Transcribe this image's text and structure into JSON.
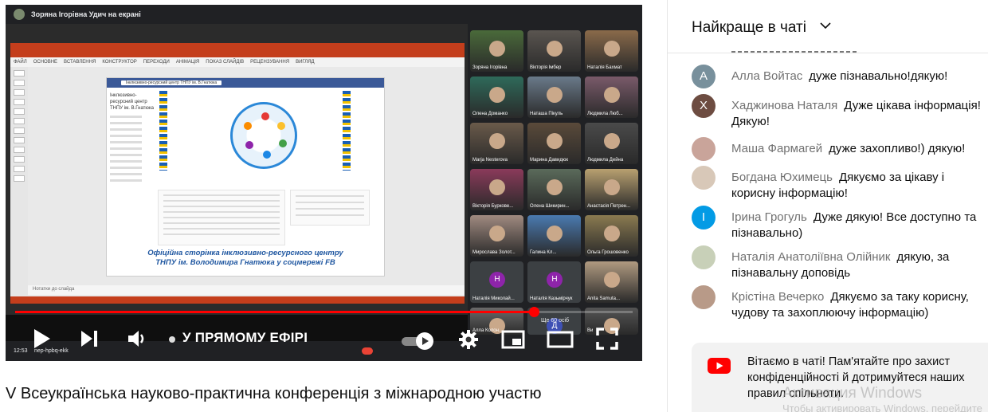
{
  "video": {
    "presenter_banner": "Зоряна Ігорівна Удич на екрані",
    "ppt_tabs": [
      "ФАЙЛ",
      "ОСНОВНЕ",
      "ВСТАВЛЕННЯ",
      "КОНСТРУКТОР",
      "ПЕРЕХОДИ",
      "АНІМАЦІЯ",
      "ПОКАЗ СЛАЙДІВ",
      "РЕЦЕНЗУВАННЯ",
      "ВИГЛЯД"
    ],
    "slide": {
      "fb_page_name": "Інклюзивно-ресурсний центр ТНПУ ім. В.Гнатюка",
      "side_title": "Інклюзивно-ресурсний центр ТНПУ ім. В.Гнатюка",
      "caption_line1": "Офіційна сторінка інклюзивно-ресурсного центру",
      "caption_line2": "ТНПУ ім. Володимира Гнатюка у соцмережі FB"
    },
    "notes_label": "Нотатки до слайда",
    "participants": [
      {
        "name": "Зоряна Ігорівна",
        "color": "#4a6a3a"
      },
      {
        "name": "Вікторія Імбер",
        "color": "#5a5550"
      },
      {
        "name": "Наталія Бахмат",
        "color": "#8a6a4a"
      },
      {
        "name": "Олена Доманко",
        "color": "#2e6a5a"
      },
      {
        "name": "Наташа Пікуль",
        "color": "#6a7a8a"
      },
      {
        "name": "Людмила Люб...",
        "color": "#7a5a6a"
      },
      {
        "name": "Marja Nesterova",
        "color": "#6a5a4a"
      },
      {
        "name": "Марина Давидюк",
        "color": "#5a4a3a"
      },
      {
        "name": "Людмила Дейна",
        "color": "#4a4a4a"
      },
      {
        "name": "Вікторія Буркове...",
        "color": "#8a3a5a"
      },
      {
        "name": "Олена Шикирин...",
        "color": "#5a6a5a"
      },
      {
        "name": "Анастасія Петрен...",
        "color": "#b8a070"
      },
      {
        "name": "Мирослава Золот...",
        "color": "#a08a80"
      },
      {
        "name": "Галина Кл...",
        "color": "#4a7ab0"
      },
      {
        "name": "Ольга Грошовенко",
        "color": "#8a7a50"
      },
      {
        "name": "Наталія Миколай...",
        "letter": "Н",
        "color": "#8e24aa"
      },
      {
        "name": "Наталія Казьмірчук",
        "letter": "Н",
        "color": "#8e24aa"
      },
      {
        "name": "Anita Samuta...",
        "color": "#b09a80"
      },
      {
        "name": "Алла Колон...",
        "color": "#6a6a6a"
      },
      {
        "name": "",
        "letter": "Д",
        "color": "#3f51b5"
      },
      {
        "name": "Ви",
        "color": "#555555"
      }
    ],
    "more_count": "Ще 60 осіб",
    "clock": "12:53",
    "meeting_code": "nep-hpbq-ekk",
    "live_label": "У ПРЯМОМУ ЕФІРІ",
    "progress": 0.84
  },
  "title": "V Всеукраїнська науково-практична конференція з міжнародною участю",
  "chat": {
    "header": "Найкраще в чаті",
    "messages": [
      {
        "author": "Алла Войтас",
        "text": "дуже пізнавально!дякую!",
        "initial": "А",
        "color": "#78909c"
      },
      {
        "author": "Хаджинова Наталя",
        "text": "Дуже цікава інформація! Дякую!",
        "initial": "Х",
        "color": "#6d4c41"
      },
      {
        "author": "Маша Фармагей",
        "text": "дуже захопливо!) дякую!",
        "initial": "",
        "color": "#c9a49a"
      },
      {
        "author": "Богдана Юхимець",
        "text": "Дякуємо за цікаву і корисну інформацію!",
        "initial": "",
        "color": "#d8c8b8"
      },
      {
        "author": "Ірина Грогуль",
        "text": "Дуже дякую! Все доступно та пізнавально)",
        "initial": "І",
        "color": "#039be5"
      },
      {
        "author": "Наталія Анатоліївна Олійник",
        "text": "дякую, за пізнавальну доповідь",
        "initial": "",
        "color": "#c8d0b8"
      },
      {
        "author": "Крістіна Вечерко",
        "text": "Дякуємо за таку корисну, чудову та захоплюючу інформацію)",
        "initial": "",
        "color": "#b89a88"
      }
    ],
    "notice": "Вітаємо в чаті! Пам'ятайте про захист конфіденційності й дотримуйтеся наших правил спільноти.",
    "watermark": "Активация Windows",
    "watermark_sub": "Чтобы активировать Windows, перейдите"
  },
  "colors": {
    "accent_red": "#ff0000",
    "youtube_red": "#ff0000",
    "meet_dark": "#202124",
    "ppt_orange": "#c43e1c"
  }
}
